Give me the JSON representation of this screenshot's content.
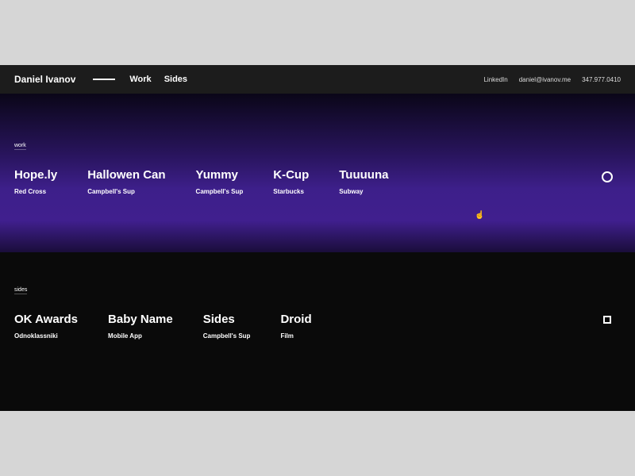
{
  "header": {
    "brand": "Daniel Ivanov",
    "nav": {
      "work": "Work",
      "sides": "Sides"
    },
    "contact": {
      "linkedin": "LinkedIn",
      "email": "daniel@ivanov.me",
      "phone": "347.977.0410"
    }
  },
  "work": {
    "label": "work",
    "items": [
      {
        "title": "Hope.ly",
        "sub": "Red Cross"
      },
      {
        "title": "Hallowen Can",
        "sub": "Campbell's Sup"
      },
      {
        "title": "Yummy",
        "sub": "Campbell's Sup"
      },
      {
        "title": "K-Cup",
        "sub": "Starbucks"
      },
      {
        "title": "Tuuuuna",
        "sub": "Subway"
      }
    ]
  },
  "sides": {
    "label": "sides",
    "items": [
      {
        "title": "OK Awards",
        "sub": "Odnoklassniki"
      },
      {
        "title": "Baby Name",
        "sub": "Mobile App"
      },
      {
        "title": "Sides",
        "sub": "Campbell's Sup"
      },
      {
        "title": "Droid",
        "sub": "Film"
      }
    ]
  }
}
